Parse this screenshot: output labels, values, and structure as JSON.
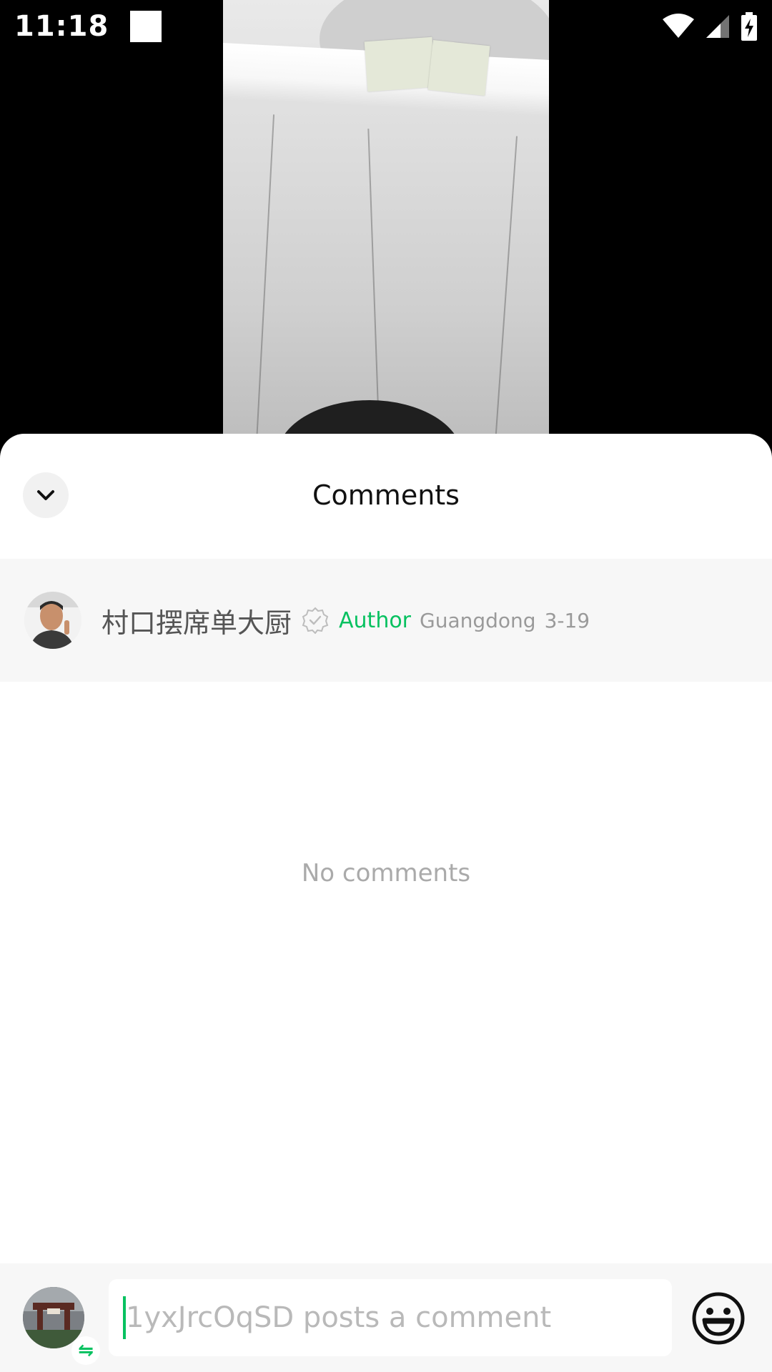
{
  "status_bar": {
    "time": "11:18"
  },
  "sheet": {
    "title": "Comments",
    "empty_text": "No comments"
  },
  "author": {
    "name": "村口摆席单大厨",
    "badge": "Author",
    "location": "Guangdong",
    "date": "3-19"
  },
  "input_bar": {
    "placeholder": "1yxJrcOqSD posts a comment"
  },
  "colors": {
    "accent": "#07c160",
    "muted_text": "#9a9a9a"
  }
}
